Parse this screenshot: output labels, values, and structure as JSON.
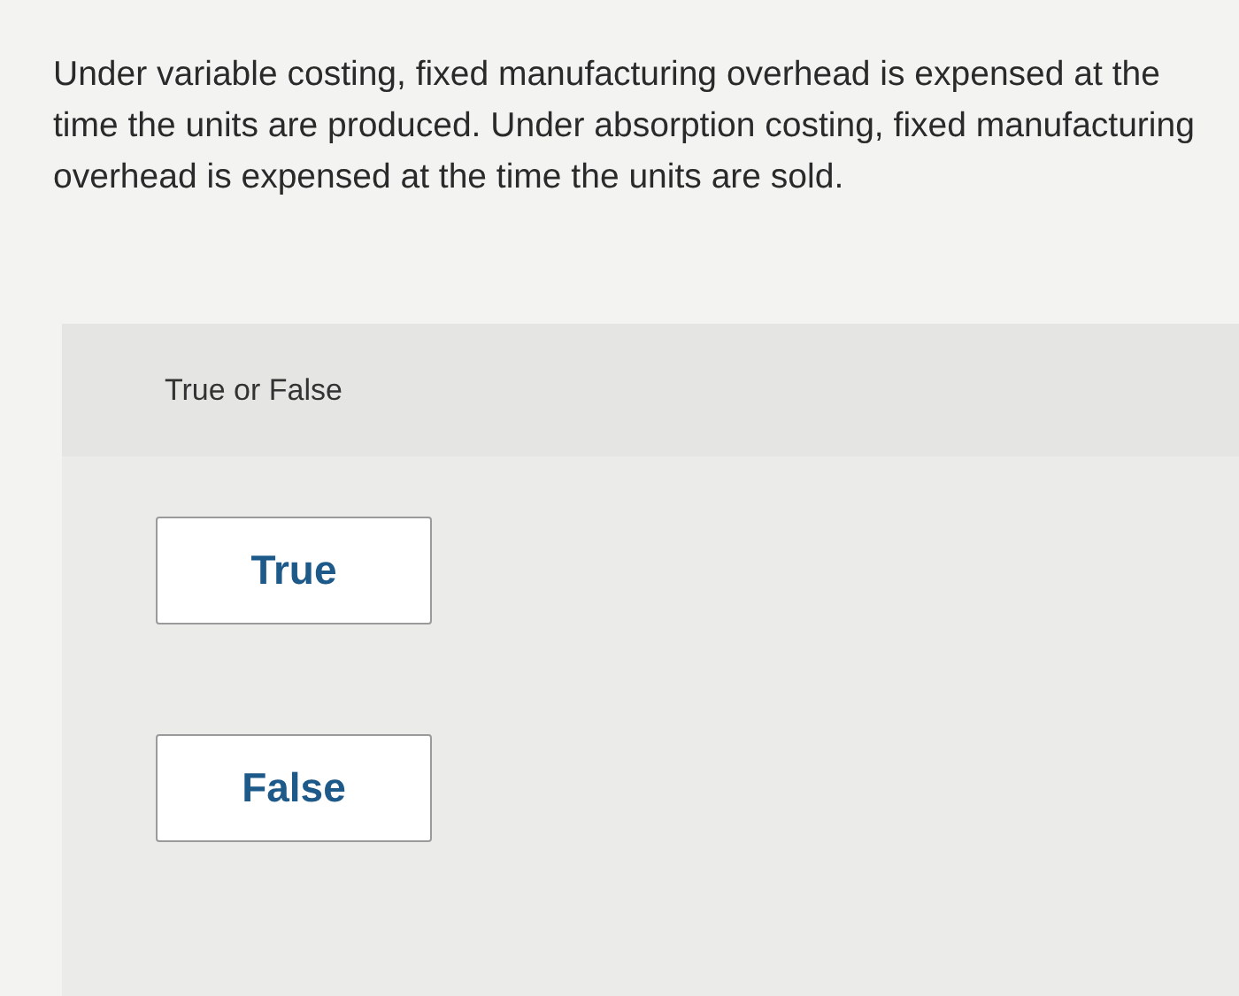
{
  "question": "Under variable costing, fixed manufacturing overhead is expensed at the time the units are produced. Under absorption costing, fixed manufacturing overhead is expensed at the time the units are sold.",
  "prompt": "True or False",
  "options": [
    {
      "label": "True",
      "selected": false
    },
    {
      "label": "False",
      "selected": false
    }
  ]
}
